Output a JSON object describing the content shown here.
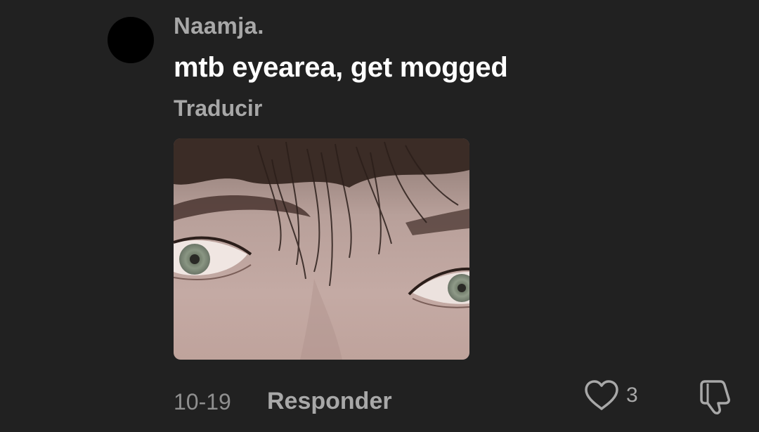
{
  "comment": {
    "username": "Naamja.",
    "text": "mtb eyearea, get mogged",
    "translate_label": "Traducir",
    "image_subject": "close-up photo of eyes with dark bangs",
    "date": "10-19",
    "reply_label": "Responder",
    "like_count": "3"
  },
  "icons": {
    "avatar": "avatar",
    "like": "heart-outline-icon",
    "dislike": "thumbs-down-icon"
  },
  "colors": {
    "background": "#212121",
    "text_primary": "#ffffff",
    "text_secondary": "#a8a8a8",
    "avatar": "#000000"
  }
}
